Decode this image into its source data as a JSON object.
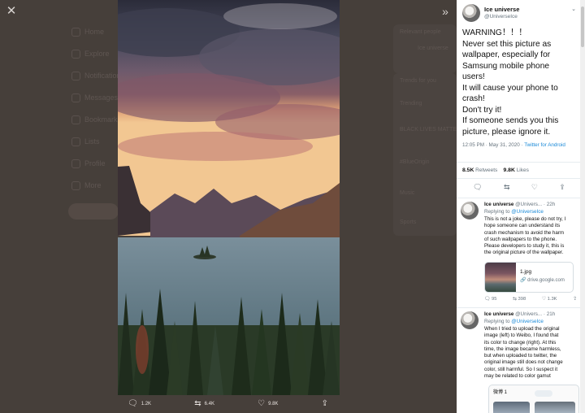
{
  "viewer": {
    "close_glyph": "✕",
    "expand_glyph": "»"
  },
  "actions": [
    {
      "icon": "reply-icon",
      "glyph": "🗨",
      "count": "1.2K"
    },
    {
      "icon": "retweet-icon",
      "glyph": "⇆",
      "count": "6.4K"
    },
    {
      "icon": "like-icon",
      "glyph": "♡",
      "count": "9.8K"
    },
    {
      "icon": "share-icon",
      "glyph": "⇪",
      "count": ""
    }
  ],
  "tweet": {
    "author_name": "Ice universe",
    "author_handle": "@UniverseIce",
    "lines": [
      "WARNING！！！",
      "Never set this picture as",
      "wallpaper, especially for",
      "Samsung mobile phone",
      "users!",
      "It will cause your phone to",
      "crash!",
      "Don't try it!",
      "If someone sends you this",
      "picture, please ignore it."
    ],
    "time": "12:05 PM · May 31, 2020 · ",
    "source": "Twitter for Android",
    "retweets_count": "8.5K",
    "retweets_label": "Retweets",
    "likes_count": "9.8K",
    "likes_label": "Likes"
  },
  "replies": [
    {
      "name": "Ice universe",
      "handle_time": "@Univers... · 22h",
      "replying_label": "Replying to",
      "replying_to": "@UniverseIce",
      "lines": [
        "This is not a joke, please do not try, I",
        "hope someone can understand its",
        "crash mechanism to avoid the harm",
        "of such wallpapers to the phone.",
        "Please developers to study it, this is",
        "the original picture of the wallpaper."
      ],
      "link_title": "1.jpg",
      "link_domain": "drive.google.com",
      "replies": "95",
      "retweets": "398",
      "likes": "1.3K"
    },
    {
      "name": "Ice universe",
      "handle_time": "@Univers... · 21h",
      "replying_label": "Replying to",
      "replying_to": "@UniverseIce",
      "lines": [
        "When I tried to upload the original",
        "image (left) to Weibo, I found that",
        "its color to change (right). At this",
        "time, the image became harmless,",
        "but when uploaded to twitter, the",
        "original image still does not change",
        "color, still harmful. So I suspect it",
        "may be related to color gamut"
      ],
      "weibo_title": "微博 1"
    }
  ],
  "background": {
    "nav": [
      "Home",
      "Explore",
      "Notifications",
      "Messages",
      "Bookmarks",
      "Lists",
      "Profile",
      "More"
    ],
    "right": [
      "Relevant people",
      "Ice universe",
      "Trends for you",
      "Trending",
      "BLACK LIVES MATTER",
      "#BlueOrigin",
      "Music",
      "Sports"
    ]
  }
}
